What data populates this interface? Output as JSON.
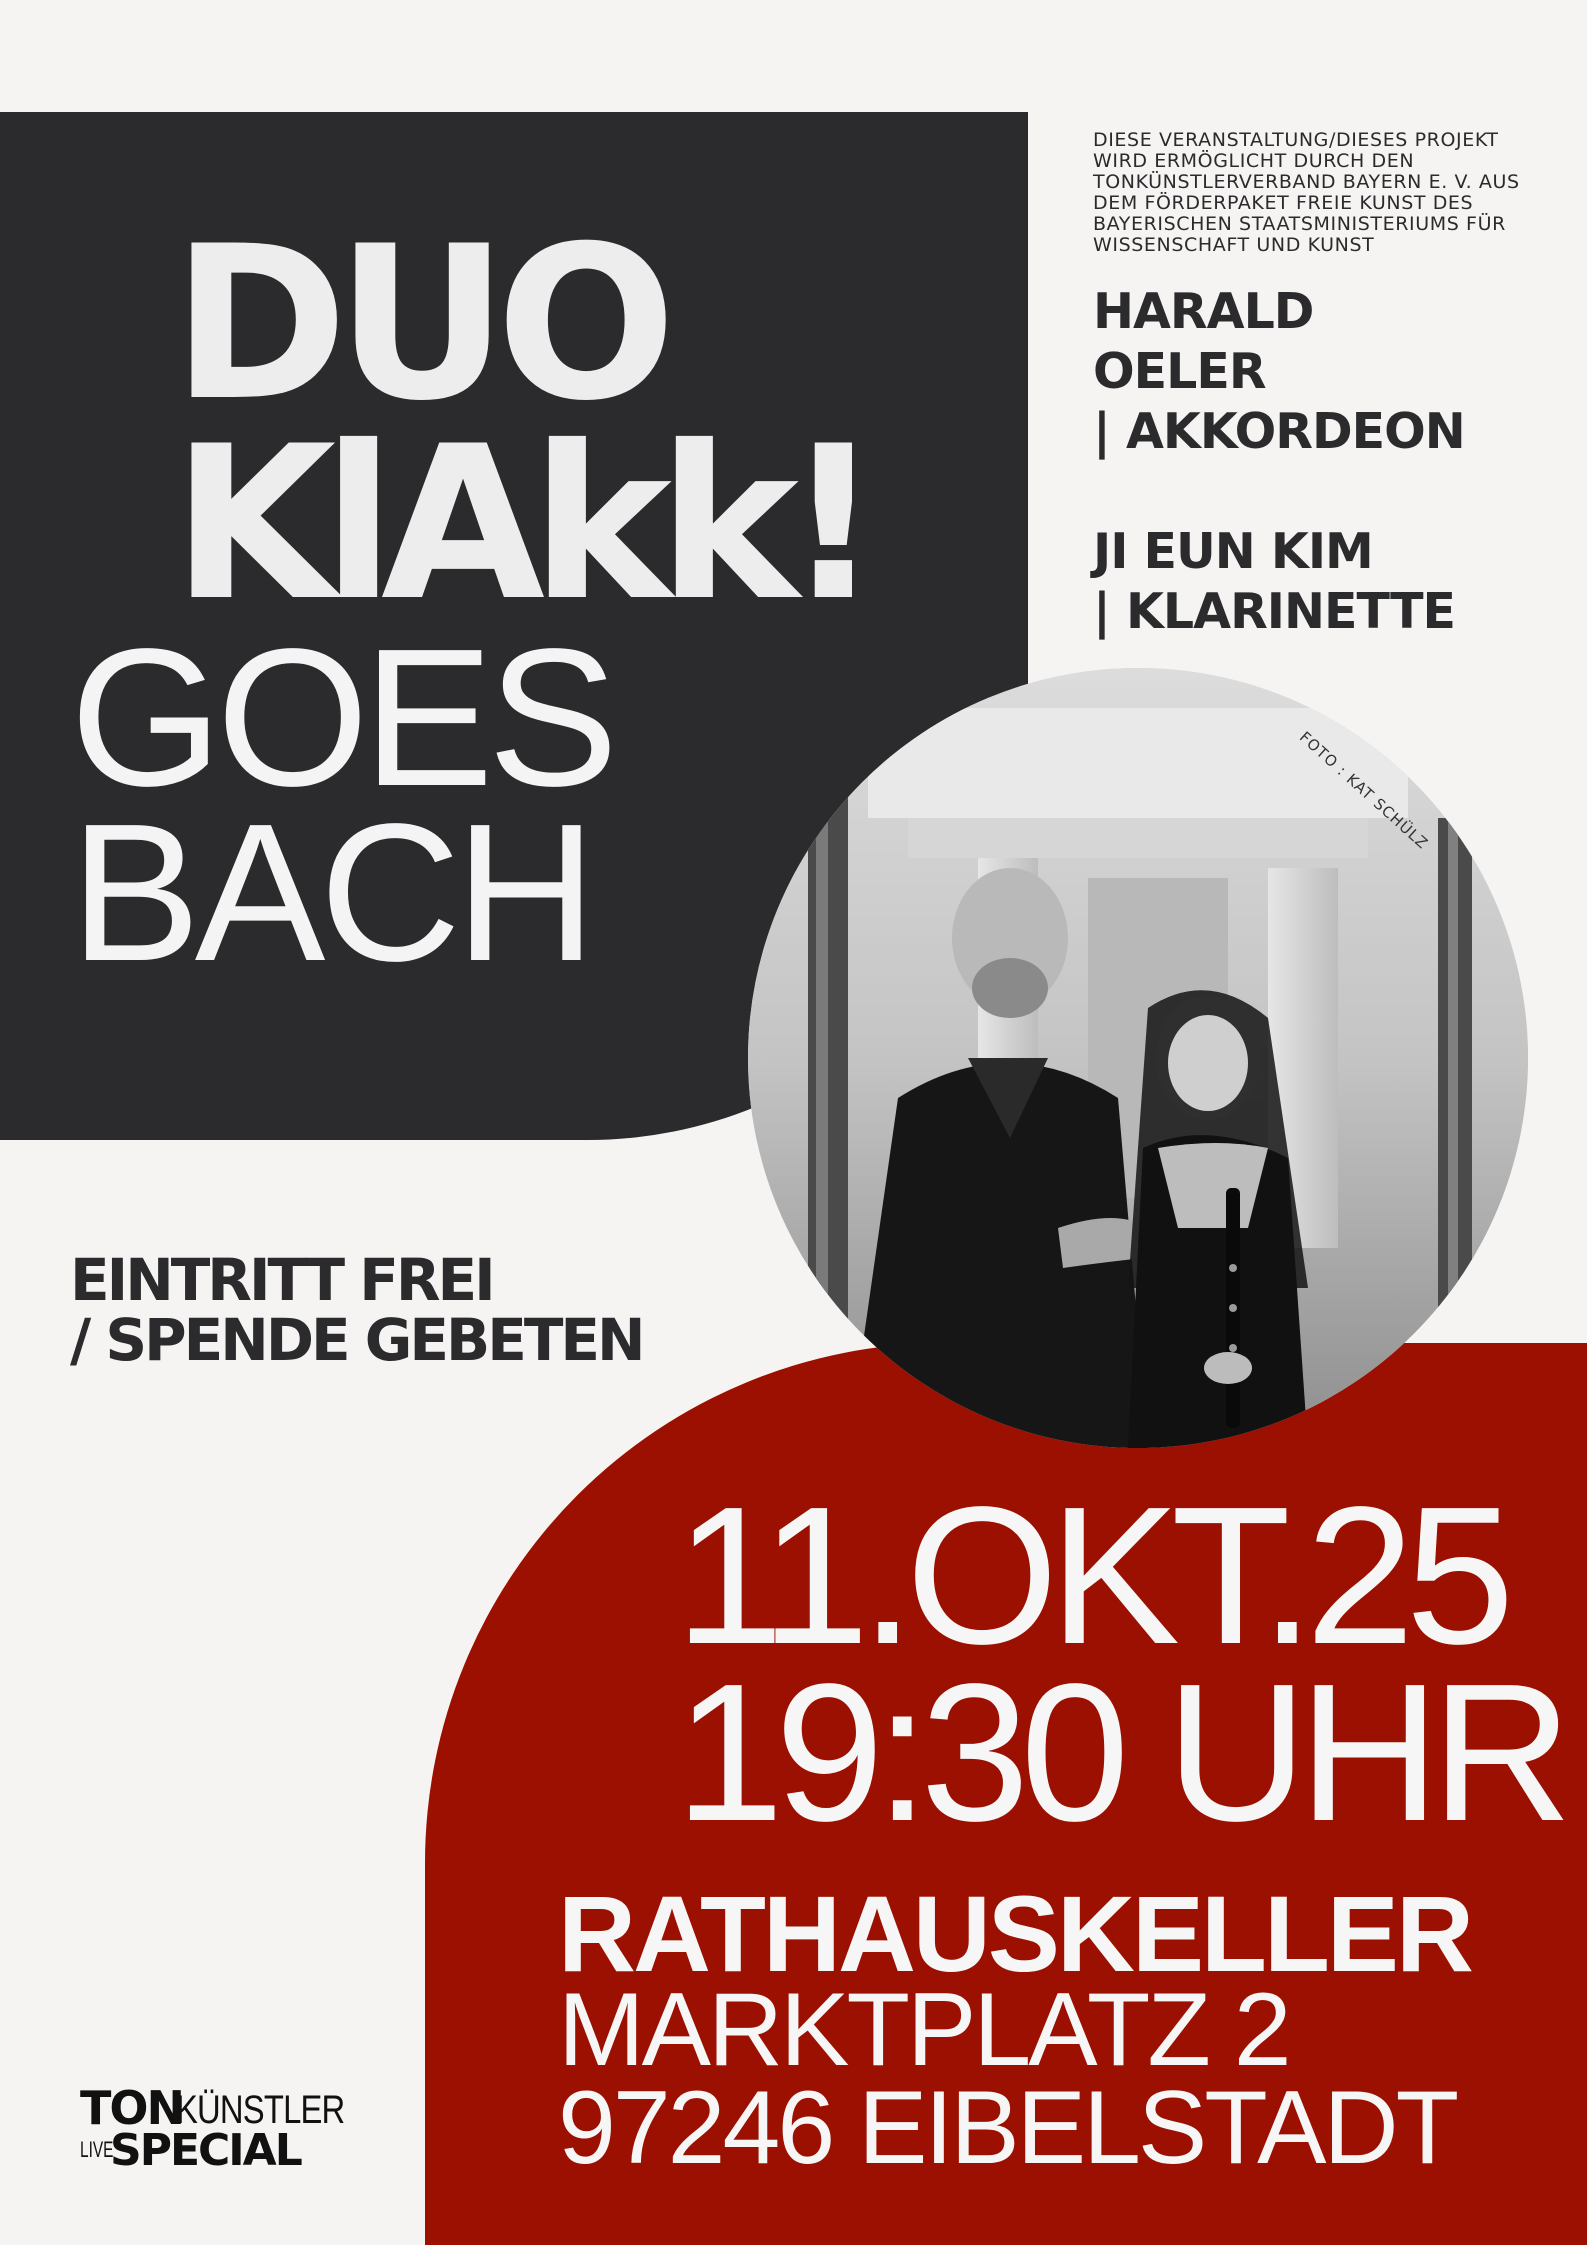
{
  "title": {
    "line1": "DUO",
    "line2": "KlAkk!",
    "line3": "GOES",
    "line4": "BACH"
  },
  "funding_note": "DIESE VERANSTALTUNG/DIESES PROJEKT WIRD ERMÖGLICHT DURCH DEN TONKÜNSTLERVERBAND BAYERN E. V. AUS DEM FÖRDERPAKET FREIE KUNST DES BAYERISCHEN STAATSMINISTERIUMS FÜR WISSENSCHAFT UND KUNST",
  "artists": [
    {
      "line1": "HARALD",
      "line2": "OELER",
      "line3": "| AKKORDEON"
    },
    {
      "line1": "JI EUN KIM",
      "line2": "| KLARINETTE"
    }
  ],
  "photo_credit": "FOTO : KAT SCHÜLZ",
  "admission": {
    "line1": "EINTRITT FREI",
    "line2": "/ SPENDE GEBETEN"
  },
  "event": {
    "date": "11.OKT.25",
    "time": "19:30 UHR",
    "venue": "RATHAUSKELLER",
    "street": "MARKTPLATZ 2",
    "city": "97246 EIBELSTADT"
  },
  "logo": {
    "ton": "TON",
    "kuenstler": "KÜNSTLER",
    "live": "LIVE",
    "special": "SPECIAL"
  },
  "colors": {
    "dark": "#2b2b2d",
    "red": "#9b1000",
    "background": "#f5f4f2",
    "light_text": "#f4f4f4"
  }
}
